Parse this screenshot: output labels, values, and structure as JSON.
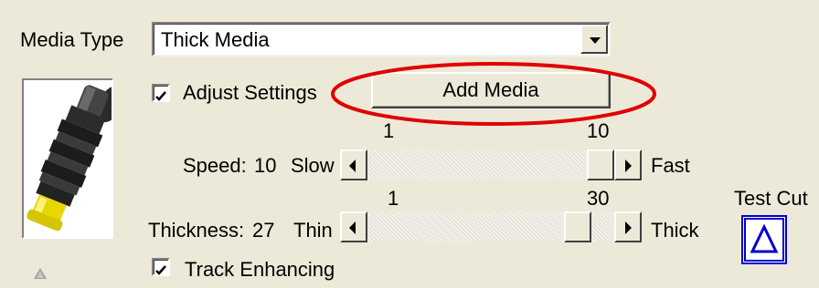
{
  "media_type": {
    "label": "Media Type",
    "value": "Thick Media"
  },
  "adjust_settings": {
    "label": "Adjust Settings",
    "checked": true
  },
  "add_media_button": {
    "label": "Add Media",
    "highlight_color": "#e00000"
  },
  "speed": {
    "label": "Speed:",
    "value": "10",
    "min_label": "Slow",
    "max_label": "Fast",
    "range_min": "1",
    "range_max": "10",
    "position_fraction": 1.0
  },
  "thickness": {
    "label": "Thickness:",
    "value": "27",
    "min_label": "Thin",
    "max_label": "Thick",
    "range_min": "1",
    "range_max": "30",
    "position_fraction": 0.897
  },
  "test_cut": {
    "label": "Test Cut",
    "icon": "triangle-icon",
    "color": "#0000cc"
  },
  "track_enhancing": {
    "label": "Track Enhancing",
    "checked": true
  },
  "media_image": {
    "icon": "pinch-roller-icon"
  },
  "small_triangle": {
    "icon": "triangle-up-icon"
  }
}
